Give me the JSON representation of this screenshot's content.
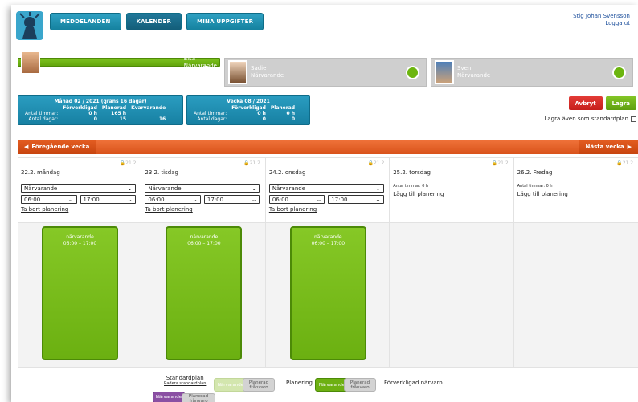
{
  "nav": {
    "tabs": [
      "MEDDELANDEN",
      "KALENDER",
      "MINA UPPGIFTER"
    ],
    "active": "KALENDER"
  },
  "user": {
    "name": "Stig Johan Svensson",
    "logout": "Logga ut"
  },
  "children": [
    {
      "name": "Elsa",
      "status": "Närvarande",
      "selected": true
    },
    {
      "name": "Sadie",
      "status": "Närvarande",
      "selected": false
    },
    {
      "name": "Sven",
      "status": "Närvarande",
      "selected": false
    }
  ],
  "month_stats": {
    "title": "Månad 02 / 2021 (gräns 16 dagar)",
    "headers": [
      "Förverkligad",
      "Planerad",
      "Kvarvarande"
    ],
    "rows": [
      {
        "label": "Antal timmar:",
        "values": [
          "0 h",
          "165 h",
          ""
        ]
      },
      {
        "label": "Antal dagar:",
        "values": [
          "0",
          "15",
          "16"
        ]
      }
    ]
  },
  "week_stats": {
    "title": "Vecka 08 / 2021",
    "headers": [
      "Förverkligad",
      "Planerad"
    ],
    "rows": [
      {
        "label": "Antal timmar:",
        "values": [
          "0 h",
          "0 h"
        ]
      },
      {
        "label": "Antal dagar:",
        "values": [
          "0",
          "0"
        ]
      }
    ]
  },
  "actions": {
    "cancel": "Avbryt",
    "save": "Lagra",
    "std_plan": "Lagra även som standardplan"
  },
  "weekbar": {
    "prev": "Föregående vecka",
    "next": "Nästa vecka"
  },
  "days": [
    {
      "lock": "21.2.",
      "name": "22.2. måndag",
      "planned": true,
      "type": "Närvarande",
      "start": "06:00",
      "end": "17:00",
      "remove": "Ta bort planering",
      "block_label": "närvarande",
      "block_time": "06:00 – 17:00"
    },
    {
      "lock": "21.2.",
      "name": "23.2. tisdag",
      "planned": true,
      "type": "Närvarande",
      "start": "06:00",
      "end": "17:00",
      "remove": "Ta bort planering",
      "block_label": "närvarande",
      "block_time": "06:00 – 17:00"
    },
    {
      "lock": "21.2.",
      "name": "24.2. onsdag",
      "planned": true,
      "type": "Närvarande",
      "start": "06:00",
      "end": "17:00",
      "remove": "Ta bort planering",
      "block_label": "närvarande",
      "block_time": "06:00 – 17:00"
    },
    {
      "lock": "21.2.",
      "name": "25.2. torsdag",
      "planned": false,
      "hours": "Antal timmar: 0 h",
      "add": "Lägg till planering"
    },
    {
      "lock": "21.2.",
      "name": "26.2. Fredag",
      "planned": false,
      "hours": "Antal timmar: 0 h",
      "add": "Lägg till planering"
    }
  ],
  "legend": {
    "std_title": "Standardplan",
    "std_remove": "Radera standardplan",
    "present": "Närvarande",
    "planned_absence": "Planerad frånvaro",
    "planning": "Planering",
    "realized": "Förverkligad närvaro"
  },
  "colors": {
    "green": "#6bb011",
    "orange": "#e05c22",
    "blue": "#1d8bb0",
    "red": "#d42b27",
    "purple": "#8a4fa3"
  }
}
